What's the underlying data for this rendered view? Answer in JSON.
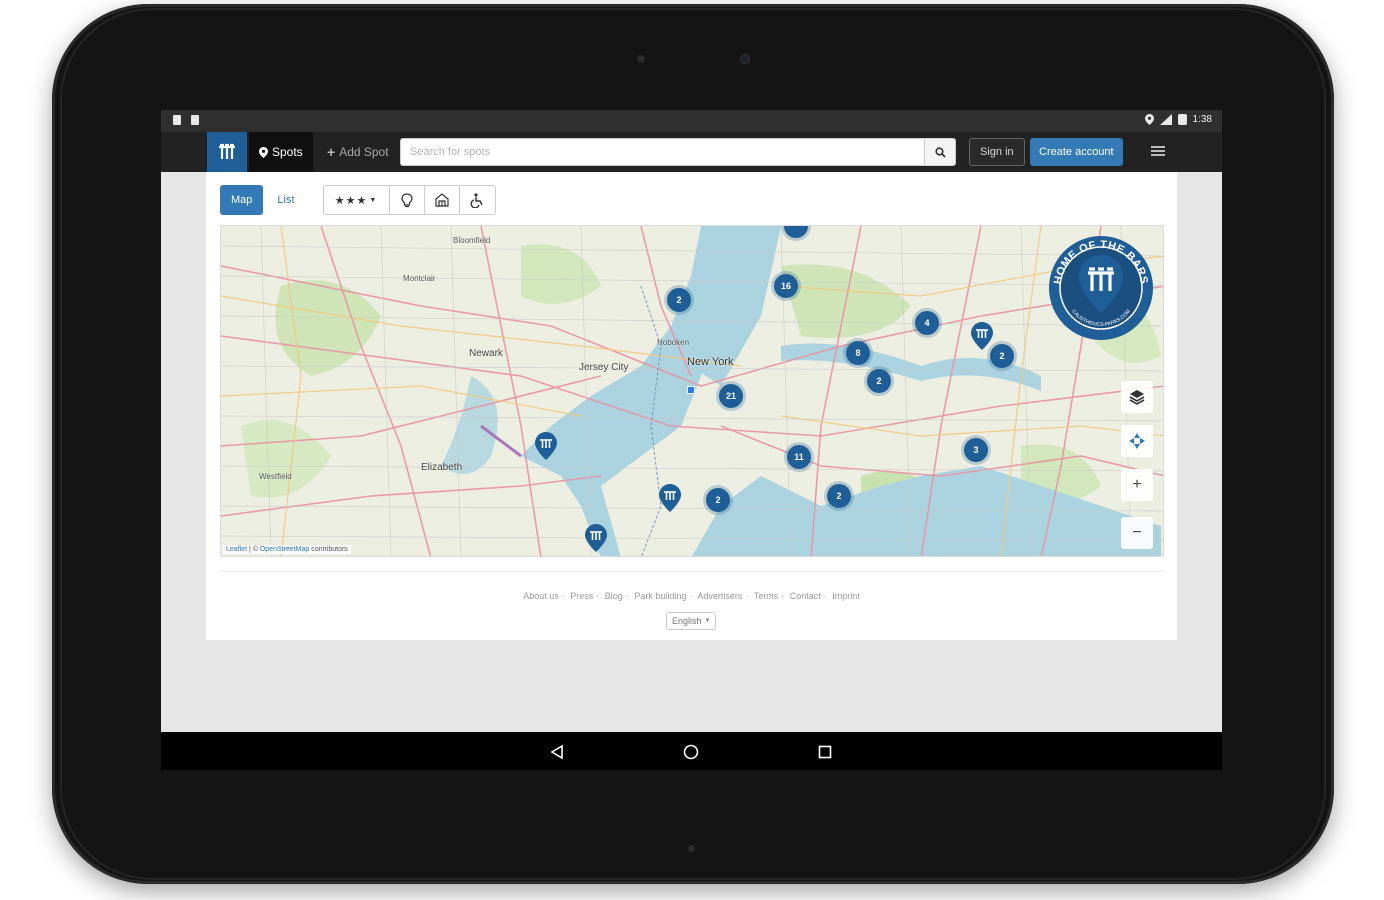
{
  "statusbar": {
    "time": "1:38",
    "icons": [
      "sd-card-icon",
      "notification-icon",
      "location-icon",
      "signal-icon",
      "battery-icon"
    ]
  },
  "navbar": {
    "brand_icon": "calisthenics-bars-icon",
    "spots_label": "Spots",
    "add_spot_label": "Add Spot",
    "search_placeholder": "Search for spots",
    "sign_in_label": "Sign in",
    "create_account_label": "Create account",
    "menu_icon": "hamburger-icon"
  },
  "toolbar": {
    "map_label": "Map",
    "list_label": "List",
    "stars_label": "★★★",
    "filters": [
      "bulb-icon",
      "shelter-icon",
      "accessibility-icon"
    ]
  },
  "map": {
    "city_labels": [
      "New York",
      "Jersey City",
      "Newark",
      "Elizabeth",
      "Montclair",
      "Bloomfield",
      "Westfield",
      "Hoboken"
    ],
    "clusters": [
      "2",
      "16",
      "4",
      "8",
      "2",
      "2",
      "21",
      "11",
      "3",
      "2",
      "2"
    ],
    "logo_text": "HOME OF THE BARS",
    "logo_subtext": "CALISTHENICS-PARKS.COM",
    "attribution_leaflet": "Leaflet",
    "attribution_osm": "OpenStreetMap",
    "attribution_rest": "contributors",
    "controls": {
      "layers_icon": "layers-icon",
      "locate_icon": "locate-icon",
      "zoom_in": "+",
      "zoom_out": "−"
    }
  },
  "footer": {
    "links": [
      "About us",
      "Press",
      "Blog",
      "Park building",
      "Advertisers",
      "Terms",
      "Contact",
      "Imprint"
    ],
    "separator": "·",
    "language": "English"
  },
  "android_nav": {
    "back": "back-icon",
    "home": "home-icon",
    "recents": "recents-icon"
  },
  "colors": {
    "brand": "#1f5e96",
    "primary": "#337ab7",
    "navbar": "#222222"
  }
}
